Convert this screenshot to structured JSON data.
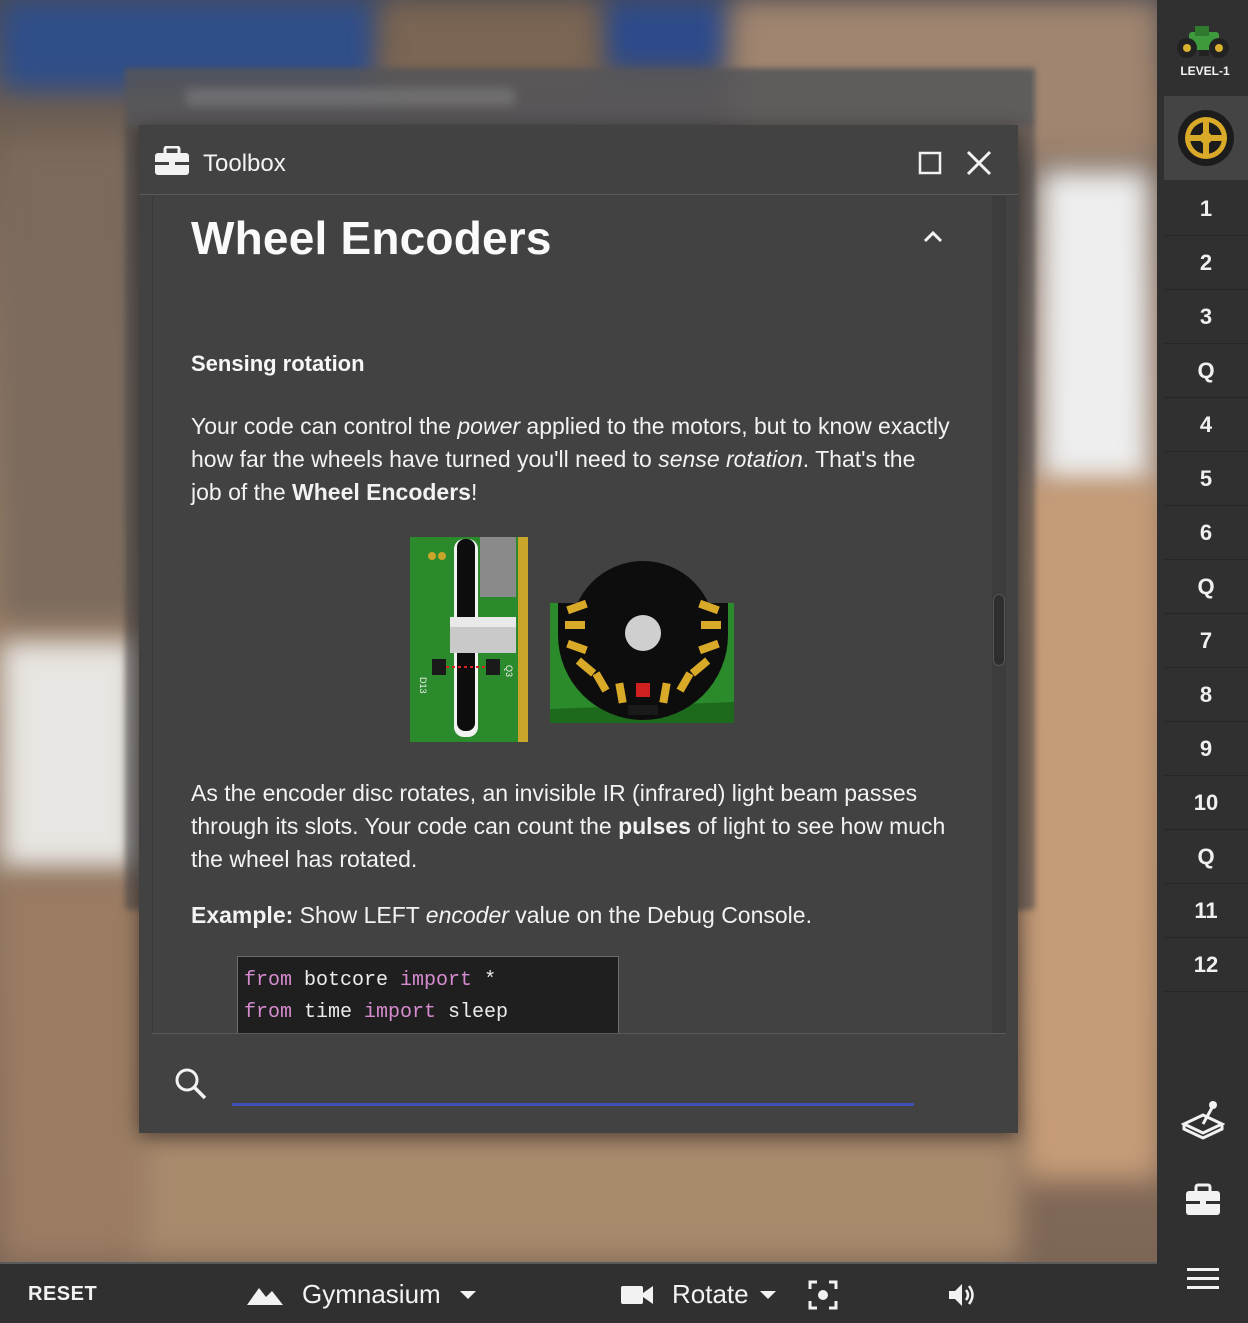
{
  "sidebar": {
    "level_label": "LEVEL-1",
    "steps": [
      "1",
      "2",
      "3",
      "Q",
      "4",
      "5",
      "6",
      "Q",
      "7",
      "8",
      "9",
      "10",
      "Q",
      "11",
      "12"
    ],
    "icons": [
      "robot-icon",
      "wheel-icon",
      "joystick-icon",
      "toolbox-icon",
      "menu-icon"
    ]
  },
  "background_window": {
    "title": "Mission 10 Using the Distance"
  },
  "toolbox": {
    "title": "Toolbox",
    "section_title": "Wheel Encoders",
    "sub_heading": "Sensing rotation",
    "p1": {
      "a": "Your code can control the ",
      "b_italic": "power",
      "c": " applied to the motors, but to know exactly how far the wheels have turned you'll need to ",
      "d_italic": "sense rotation",
      "e": ". That's the job of the ",
      "f_bold": "Wheel Encoders",
      "g": "!"
    },
    "p2": {
      "a": "As the encoder disc rotates, an invisible IR (infrared) light beam passes through its slots. Your code can count the ",
      "b_bold": "pulses",
      "c": " of light to see how much the wheel has rotated."
    },
    "p3": {
      "a_bold": "Example:",
      "b": " Show LEFT ",
      "c_italic": "encoder",
      "d": " value on the Debug Console."
    },
    "board_labels": {
      "left": "D13",
      "right": "Q3"
    },
    "code": {
      "line1": {
        "kw1": "from",
        "mod": " botcore ",
        "kw2": "import",
        "rest": " *"
      },
      "line2": {
        "kw1": "from",
        "mod": " time ",
        "kw2": "import",
        "rest": " sleep"
      }
    },
    "search": {
      "placeholder": "",
      "value": ""
    },
    "accent_color": "#3f51b5"
  },
  "bottombar": {
    "reset_label": "RESET",
    "environment": "Gymnasium",
    "camera": "Rotate",
    "icons": [
      "mountain-icon",
      "video-camera-icon",
      "focus-icon",
      "volume-icon"
    ]
  }
}
